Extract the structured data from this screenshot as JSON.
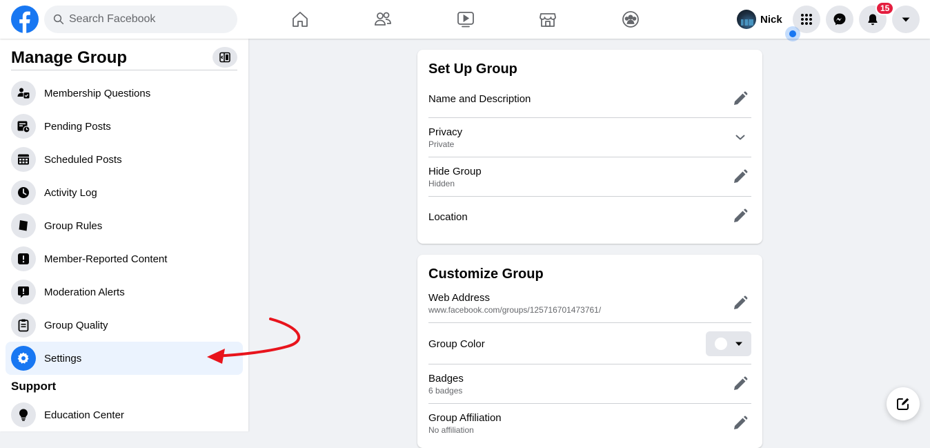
{
  "topbar": {
    "search": {
      "placeholder": "Search Facebook"
    },
    "profile_name": "Nick",
    "notification_count": "15",
    "nav": [
      "home-icon",
      "friends-icon",
      "watch-icon",
      "marketplace-icon",
      "groups-icon"
    ]
  },
  "sidebar": {
    "title": "Manage Group",
    "items": [
      {
        "label": "Membership Questions",
        "icon": "membership-questions-icon"
      },
      {
        "label": "Pending Posts",
        "icon": "pending-posts-icon"
      },
      {
        "label": "Scheduled Posts",
        "icon": "calendar-icon"
      },
      {
        "label": "Activity Log",
        "icon": "clock-icon"
      },
      {
        "label": "Group Rules",
        "icon": "book-icon"
      },
      {
        "label": "Member-Reported Content",
        "icon": "alert-icon"
      },
      {
        "label": "Moderation Alerts",
        "icon": "speech-alert-icon"
      },
      {
        "label": "Group Quality",
        "icon": "clipboard-icon"
      },
      {
        "label": "Settings",
        "icon": "gear-icon",
        "active": true
      }
    ],
    "support_label": "Support",
    "support_items": [
      {
        "label": "Education Center",
        "icon": "lightbulb-icon"
      }
    ]
  },
  "setup_card": {
    "title": "Set Up Group",
    "rows": [
      {
        "label": "Name and Description",
        "sub": ""
      },
      {
        "label": "Privacy",
        "sub": "Private"
      },
      {
        "label": "Hide Group",
        "sub": "Hidden"
      },
      {
        "label": "Location",
        "sub": ""
      }
    ]
  },
  "customize_card": {
    "title": "Customize Group",
    "rows": [
      {
        "label": "Web Address",
        "sub": "www.facebook.com/groups/125716701473761/"
      },
      {
        "label": "Group Color",
        "sub": ""
      },
      {
        "label": "Badges",
        "sub": "6 badges"
      },
      {
        "label": "Group Affiliation",
        "sub": "No affiliation"
      }
    ]
  },
  "colors": {
    "brand_blue": "#1877f2",
    "badge_red": "#e41e3f",
    "annotation_arrow": "#e8141c",
    "active_bg": "#ebf3fe",
    "group_color_swatch": "#ffffff"
  }
}
